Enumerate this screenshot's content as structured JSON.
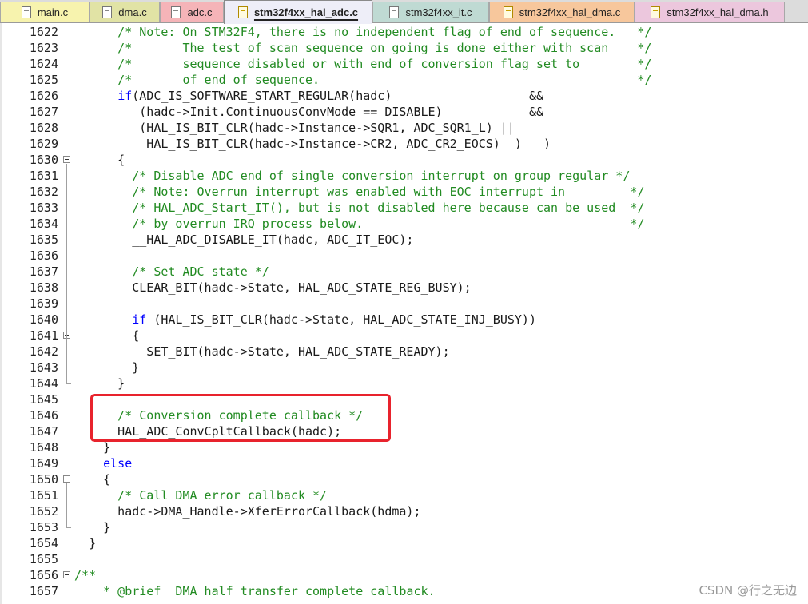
{
  "tabs": [
    {
      "label": "main.c",
      "icon": "c-file-icon",
      "color": "#f7f3ae",
      "active": false
    },
    {
      "label": "dma.c",
      "icon": "c-file-icon",
      "color": "#e1e3a5",
      "active": false
    },
    {
      "label": "adc.c",
      "icon": "c-file-icon",
      "color": "#f5b4b8",
      "active": false
    },
    {
      "label": "stm32f4xx_hal_adc.c",
      "icon": "locked-c-file-icon",
      "color": "#eeeef8",
      "active": true
    },
    {
      "label": "stm32f4xx_it.c",
      "icon": "c-file-icon",
      "color": "#bfdad3",
      "active": false
    },
    {
      "label": "stm32f4xx_hal_dma.c",
      "icon": "locked-c-file-icon",
      "color": "#f7c79c",
      "active": false
    },
    {
      "label": "stm32f4xx_hal_dma.h",
      "icon": "locked-h-file-icon",
      "color": "#ecc7dd",
      "active": false
    }
  ],
  "colors": {
    "comment": "#228b22",
    "keyword": "#0000ff",
    "text": "#1a1a1a",
    "highlight_box": "#e8232d"
  },
  "code_lines": [
    {
      "n": "1622",
      "parts": [
        [
          "c",
          "      /* Note: On STM32F4, there is no independent flag of end of sequence.   */"
        ]
      ]
    },
    {
      "n": "1623",
      "parts": [
        [
          "c",
          "      /*       The test of scan sequence on going is done either with scan    */"
        ]
      ]
    },
    {
      "n": "1624",
      "parts": [
        [
          "c",
          "      /*       sequence disabled or with end of conversion flag set to        */"
        ]
      ]
    },
    {
      "n": "1625",
      "parts": [
        [
          "c",
          "      /*       of end of sequence.                                            */"
        ]
      ]
    },
    {
      "n": "1626",
      "parts": [
        [
          "t",
          "      "
        ],
        [
          "k",
          "if"
        ],
        [
          "t",
          "(ADC_IS_SOFTWARE_START_REGULAR(hadc)                   &&"
        ]
      ]
    },
    {
      "n": "1627",
      "parts": [
        [
          "t",
          "         (hadc->Init.ContinuousConvMode == DISABLE)            &&"
        ]
      ]
    },
    {
      "n": "1628",
      "parts": [
        [
          "t",
          "         (HAL_IS_BIT_CLR(hadc->Instance->SQR1, ADC_SQR1_L) ||"
        ]
      ]
    },
    {
      "n": "1629",
      "parts": [
        [
          "t",
          "          HAL_IS_BIT_CLR(hadc->Instance->CR2, ADC_CR2_EOCS)  )   )"
        ]
      ]
    },
    {
      "n": "1630",
      "fold": true,
      "parts": [
        [
          "t",
          "      {"
        ]
      ]
    },
    {
      "n": "1631",
      "parts": [
        [
          "c",
          "        /* Disable ADC end of single conversion interrupt on group regular */"
        ]
      ]
    },
    {
      "n": "1632",
      "parts": [
        [
          "c",
          "        /* Note: Overrun interrupt was enabled with EOC interrupt in         */"
        ]
      ]
    },
    {
      "n": "1633",
      "parts": [
        [
          "c",
          "        /* HAL_ADC_Start_IT(), but is not disabled here because can be used  */"
        ]
      ]
    },
    {
      "n": "1634",
      "parts": [
        [
          "c",
          "        /* by overrun IRQ process below.                                     */"
        ]
      ]
    },
    {
      "n": "1635",
      "parts": [
        [
          "t",
          "        __HAL_ADC_DISABLE_IT(hadc, ADC_IT_EOC);"
        ]
      ]
    },
    {
      "n": "1636",
      "parts": [
        [
          "t",
          ""
        ]
      ]
    },
    {
      "n": "1637",
      "parts": [
        [
          "c",
          "        /* Set ADC state */"
        ]
      ]
    },
    {
      "n": "1638",
      "parts": [
        [
          "t",
          "        CLEAR_BIT(hadc->State, HAL_ADC_STATE_REG_BUSY);"
        ]
      ]
    },
    {
      "n": "1639",
      "parts": [
        [
          "t",
          ""
        ]
      ]
    },
    {
      "n": "1640",
      "parts": [
        [
          "t",
          "        "
        ],
        [
          "k",
          "if"
        ],
        [
          "t",
          " (HAL_IS_BIT_CLR(hadc->State, HAL_ADC_STATE_INJ_BUSY))"
        ]
      ]
    },
    {
      "n": "1641",
      "fold": true,
      "parts": [
        [
          "t",
          "        {"
        ]
      ]
    },
    {
      "n": "1642",
      "parts": [
        [
          "t",
          "          SET_BIT(hadc->State, HAL_ADC_STATE_READY);"
        ]
      ]
    },
    {
      "n": "1643",
      "parts": [
        [
          "t",
          "        }"
        ]
      ]
    },
    {
      "n": "1644",
      "parts": [
        [
          "t",
          "      }"
        ]
      ]
    },
    {
      "n": "1645",
      "parts": [
        [
          "t",
          ""
        ]
      ]
    },
    {
      "n": "1646",
      "parts": [
        [
          "c",
          "      /* Conversion complete callback */"
        ]
      ]
    },
    {
      "n": "1647",
      "parts": [
        [
          "t",
          "      HAL_ADC_ConvCpltCallback(hadc);"
        ]
      ]
    },
    {
      "n": "1648",
      "parts": [
        [
          "t",
          "    }"
        ]
      ]
    },
    {
      "n": "1649",
      "parts": [
        [
          "t",
          "    "
        ],
        [
          "k",
          "else"
        ]
      ]
    },
    {
      "n": "1650",
      "fold": true,
      "parts": [
        [
          "t",
          "    {"
        ]
      ]
    },
    {
      "n": "1651",
      "parts": [
        [
          "c",
          "      /* Call DMA error callback */"
        ]
      ]
    },
    {
      "n": "1652",
      "parts": [
        [
          "t",
          "      hadc->DMA_Handle->XferErrorCallback(hdma);"
        ]
      ]
    },
    {
      "n": "1653",
      "parts": [
        [
          "t",
          "    }"
        ]
      ]
    },
    {
      "n": "1654",
      "parts": [
        [
          "t",
          "  }"
        ]
      ]
    },
    {
      "n": "1655",
      "parts": [
        [
          "t",
          ""
        ]
      ]
    },
    {
      "n": "1656",
      "fold": true,
      "parts": [
        [
          "c",
          "/**"
        ]
      ]
    },
    {
      "n": "1657",
      "parts": [
        [
          "c",
          "    * @brief  DMA half transfer complete callback."
        ]
      ]
    }
  ],
  "watermark": "CSDN @行之无边"
}
